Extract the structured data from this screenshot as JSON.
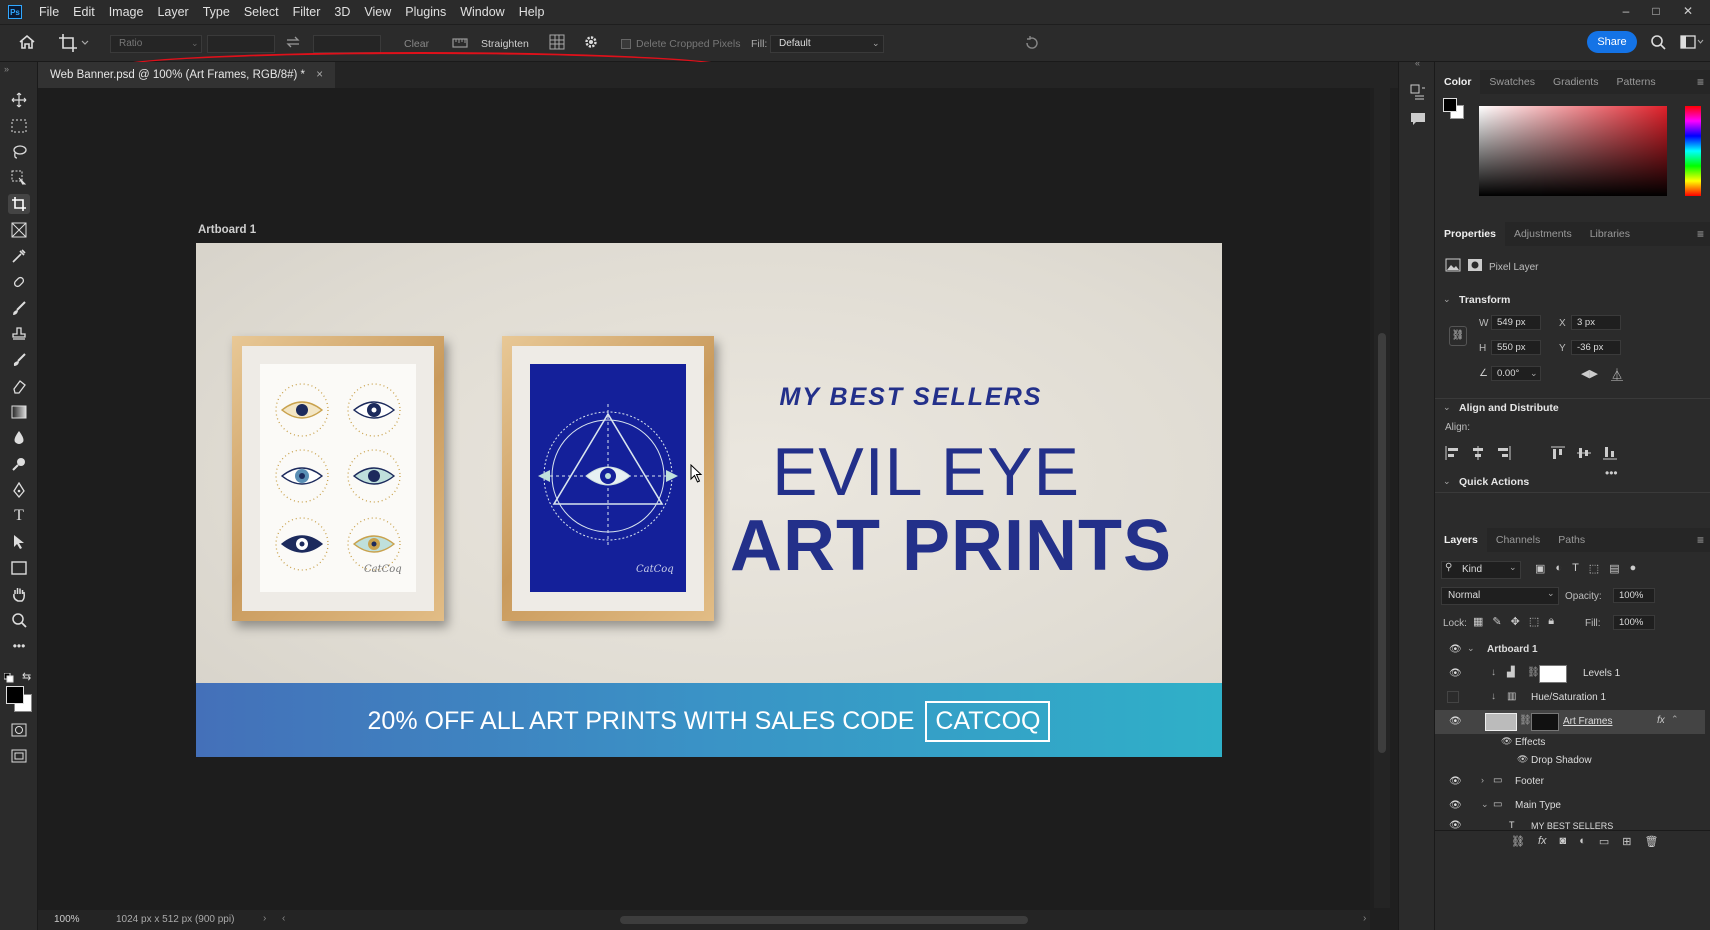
{
  "app": {
    "logo": "Ps"
  },
  "menu": [
    "File",
    "Edit",
    "Image",
    "Layer",
    "Type",
    "Select",
    "Filter",
    "3D",
    "View",
    "Plugins",
    "Window",
    "Help"
  ],
  "window_controls": {
    "minimize": "–",
    "maximize": "□",
    "close": "✕"
  },
  "options": {
    "ratio_placeholder": "Ratio",
    "clear_label": "Clear",
    "straighten_label": "Straighten",
    "delete_cropped_label": "Delete Cropped Pixels",
    "fill_label": "Fill:",
    "fill_value": "Default",
    "share_label": "Share",
    "highlight_color": "#e0101a"
  },
  "document": {
    "tab_title": "Web Banner.psd @ 100% (Art Frames, RGB/8#) *",
    "tab_close": "×",
    "artboard_label": "Artboard 1",
    "zoom": "100%",
    "doc_info": "1024 px x 512 px (900 ppi)"
  },
  "banner": {
    "best_sellers": "MY BEST SELLERS",
    "line1": "EVIL EYE",
    "line2": "ART PRINTS",
    "sale_text": "20% OFF ALL ART PRINTS WITH SALES CODE",
    "code": "CATCOQ",
    "signature": "CatCoq",
    "text_color": "#23308a"
  },
  "color_panel": {
    "tabs": [
      "Color",
      "Swatches",
      "Gradients",
      "Patterns"
    ]
  },
  "properties_panel": {
    "tabs": [
      "Properties",
      "Adjustments",
      "Libraries"
    ],
    "layer_type": "Pixel Layer",
    "transform_heading": "Transform",
    "w_label": "W",
    "w_value": "549 px",
    "h_label": "H",
    "h_value": "550 px",
    "x_label": "X",
    "x_value": "3 px",
    "y_label": "Y",
    "y_value": "-36 px",
    "angle_value": "0.00°",
    "align_heading": "Align and Distribute",
    "align_label": "Align:",
    "quick_actions": "Quick Actions"
  },
  "layers_panel": {
    "tabs": [
      "Layers",
      "Channels",
      "Paths"
    ],
    "filter_kind": "Kind",
    "blend_mode": "Normal",
    "opacity_label": "Opacity:",
    "opacity_value": "100%",
    "lock_label": "Lock:",
    "fill_label": "Fill:",
    "fill_value": "100%",
    "layers": [
      {
        "name": "Artboard 1"
      },
      {
        "name": "Levels 1"
      },
      {
        "name": "Hue/Saturation 1"
      },
      {
        "name": "Art Frames"
      },
      {
        "name": "Effects"
      },
      {
        "name": "Drop Shadow"
      },
      {
        "name": "Footer"
      },
      {
        "name": "Main Type"
      },
      {
        "name": "MY BEST SELLERS"
      }
    ]
  }
}
